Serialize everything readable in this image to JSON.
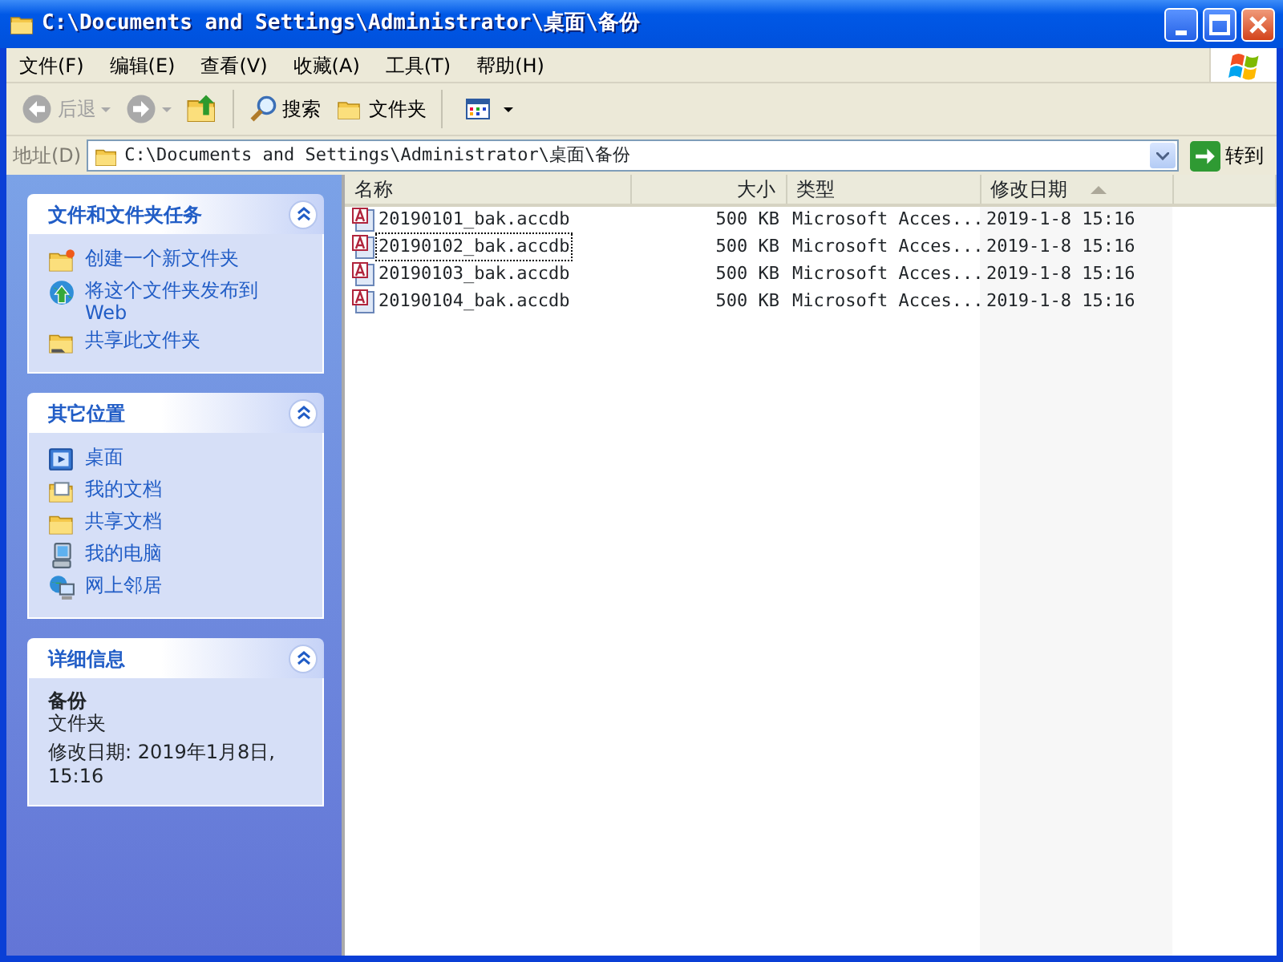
{
  "window": {
    "title": "C:\\Documents and Settings\\Administrator\\桌面\\备份"
  },
  "menu": [
    "文件(F)",
    "编辑(E)",
    "查看(V)",
    "收藏(A)",
    "工具(T)",
    "帮助(H)"
  ],
  "toolbar": [
    {
      "kind": "back",
      "label": "后退",
      "disabled": true
    },
    {
      "kind": "forward",
      "disabled": true
    },
    {
      "kind": "up",
      "disabled": false
    },
    {
      "kind": "search",
      "label": "搜索",
      "disabled": false
    },
    {
      "kind": "folders",
      "label": "文件夹",
      "disabled": false
    },
    {
      "kind": "views",
      "disabled": false
    }
  ],
  "address": {
    "label": "地址(D)",
    "value": "C:\\Documents and Settings\\Administrator\\桌面\\备份",
    "go": "转到"
  },
  "panels": [
    {
      "kind": "tasks",
      "title": "文件和文件夹任务",
      "expanded": true,
      "items": [
        {
          "kind": "new-folder",
          "label": "创建一个新文件夹"
        },
        {
          "kind": "publish",
          "label": "将这个文件夹发布到 Web"
        },
        {
          "kind": "share",
          "label": "共享此文件夹"
        }
      ]
    },
    {
      "kind": "places",
      "title": "其它位置",
      "expanded": true,
      "items": [
        {
          "kind": "desktop",
          "label": "桌面"
        },
        {
          "kind": "documents",
          "label": "我的文档"
        },
        {
          "kind": "folder",
          "label": "共享文档"
        },
        {
          "kind": "computer",
          "label": "我的电脑"
        },
        {
          "kind": "network",
          "label": "网上邻居"
        }
      ]
    },
    {
      "kind": "details",
      "title": "详细信息",
      "expanded": true,
      "name": "备份",
      "type": "文件夹",
      "modified": "修改日期: 2019年1月8日, 15:16"
    }
  ],
  "table": {
    "columns": [
      {
        "kind": "name",
        "label": "名称",
        "sorted": false
      },
      {
        "kind": "size",
        "label": "大小",
        "sorted": false
      },
      {
        "kind": "type",
        "label": "类型",
        "sorted": false
      },
      {
        "kind": "date",
        "label": "修改日期",
        "sorted": true
      }
    ],
    "rows": [
      {
        "cells": [
          "20190101_bak.accdb",
          "500 KB",
          "Microsoft Acces...",
          "2019-1-8 15:16"
        ],
        "focused": false
      },
      {
        "cells": [
          "20190102_bak.accdb",
          "500 KB",
          "Microsoft Acces...",
          "2019-1-8 15:16"
        ],
        "focused": true
      },
      {
        "cells": [
          "20190103_bak.accdb",
          "500 KB",
          "Microsoft Acces...",
          "2019-1-8 15:16"
        ],
        "focused": false
      },
      {
        "cells": [
          "20190104_bak.accdb",
          "500 KB",
          "Microsoft Acces...",
          "2019-1-8 15:16"
        ],
        "focused": false
      }
    ]
  }
}
